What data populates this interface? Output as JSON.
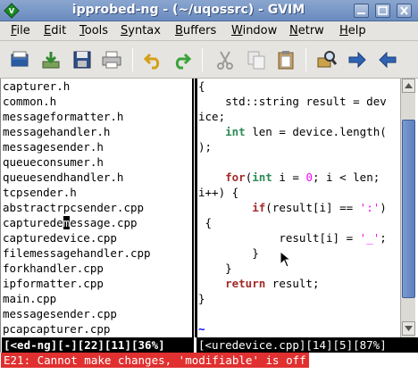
{
  "window": {
    "title": "ipprobed-ng - (~/uqossrc) - GVIM",
    "buttons": [
      "minimize",
      "maximize",
      "close"
    ]
  },
  "menubar": [
    {
      "label": "File",
      "u": "F",
      "rest": "ile"
    },
    {
      "label": "Edit",
      "u": "E",
      "rest": "dit"
    },
    {
      "label": "Tools",
      "u": "T",
      "rest": "ools"
    },
    {
      "label": "Syntax",
      "u": "S",
      "rest": "yntax"
    },
    {
      "label": "Buffers",
      "u": "B",
      "rest": "uffers"
    },
    {
      "label": "Window",
      "u": "W",
      "rest": "indow"
    },
    {
      "label": "Netrw",
      "u": "N",
      "rest": "etrw"
    },
    {
      "label": "Help",
      "u": "H",
      "rest": "elp"
    }
  ],
  "toolbar": [
    "open-icon",
    "download-icon",
    "save-icon",
    "print-icon",
    "undo-icon",
    "redo-icon",
    "cut-icon",
    "copy-icon",
    "paste-icon",
    "find-replace-icon",
    "forward-icon",
    "back-icon"
  ],
  "left_pane": {
    "lines": [
      "capturer.h",
      "common.h",
      "messageformatter.h",
      "messagehandler.h",
      "messagesender.h",
      "queueconsumer.h",
      "queuesendhandler.h",
      "tcpsender.h",
      "abstractrpcsender.cpp",
      "capturedemessage.cpp",
      "capturedevice.cpp",
      "filemessagehandler.cpp",
      "forkhandler.cpp",
      "ipformatter.cpp",
      "main.cpp",
      "messagesender.cpp",
      "pcapcapturer.cpp"
    ],
    "cursor_line": 9,
    "cursor_col": 9
  },
  "right_pane": {
    "lines": [
      "{",
      "    std::string result = dev",
      "ice;",
      "    int len = device.length(",
      ");",
      "",
      "    for(int i = 0; i < len;",
      "i++) {",
      "        if(result[i] == ':')",
      " {",
      "            result[i] = '_';",
      "        }",
      "    }",
      "    return result;",
      "}",
      "",
      "~"
    ]
  },
  "status": {
    "left": "[<ed-ng][-][22][11][36%]",
    "right": "[<uredevice.cpp][14][5][87%]"
  },
  "message": "E21: Cannot make changes, 'modifiable' is off",
  "colors": {
    "keyword": "#a52a2a",
    "type": "#2e8b57",
    "constant": "#ff00ff",
    "error_bg": "#e03030",
    "tilde": "#0000ff"
  }
}
